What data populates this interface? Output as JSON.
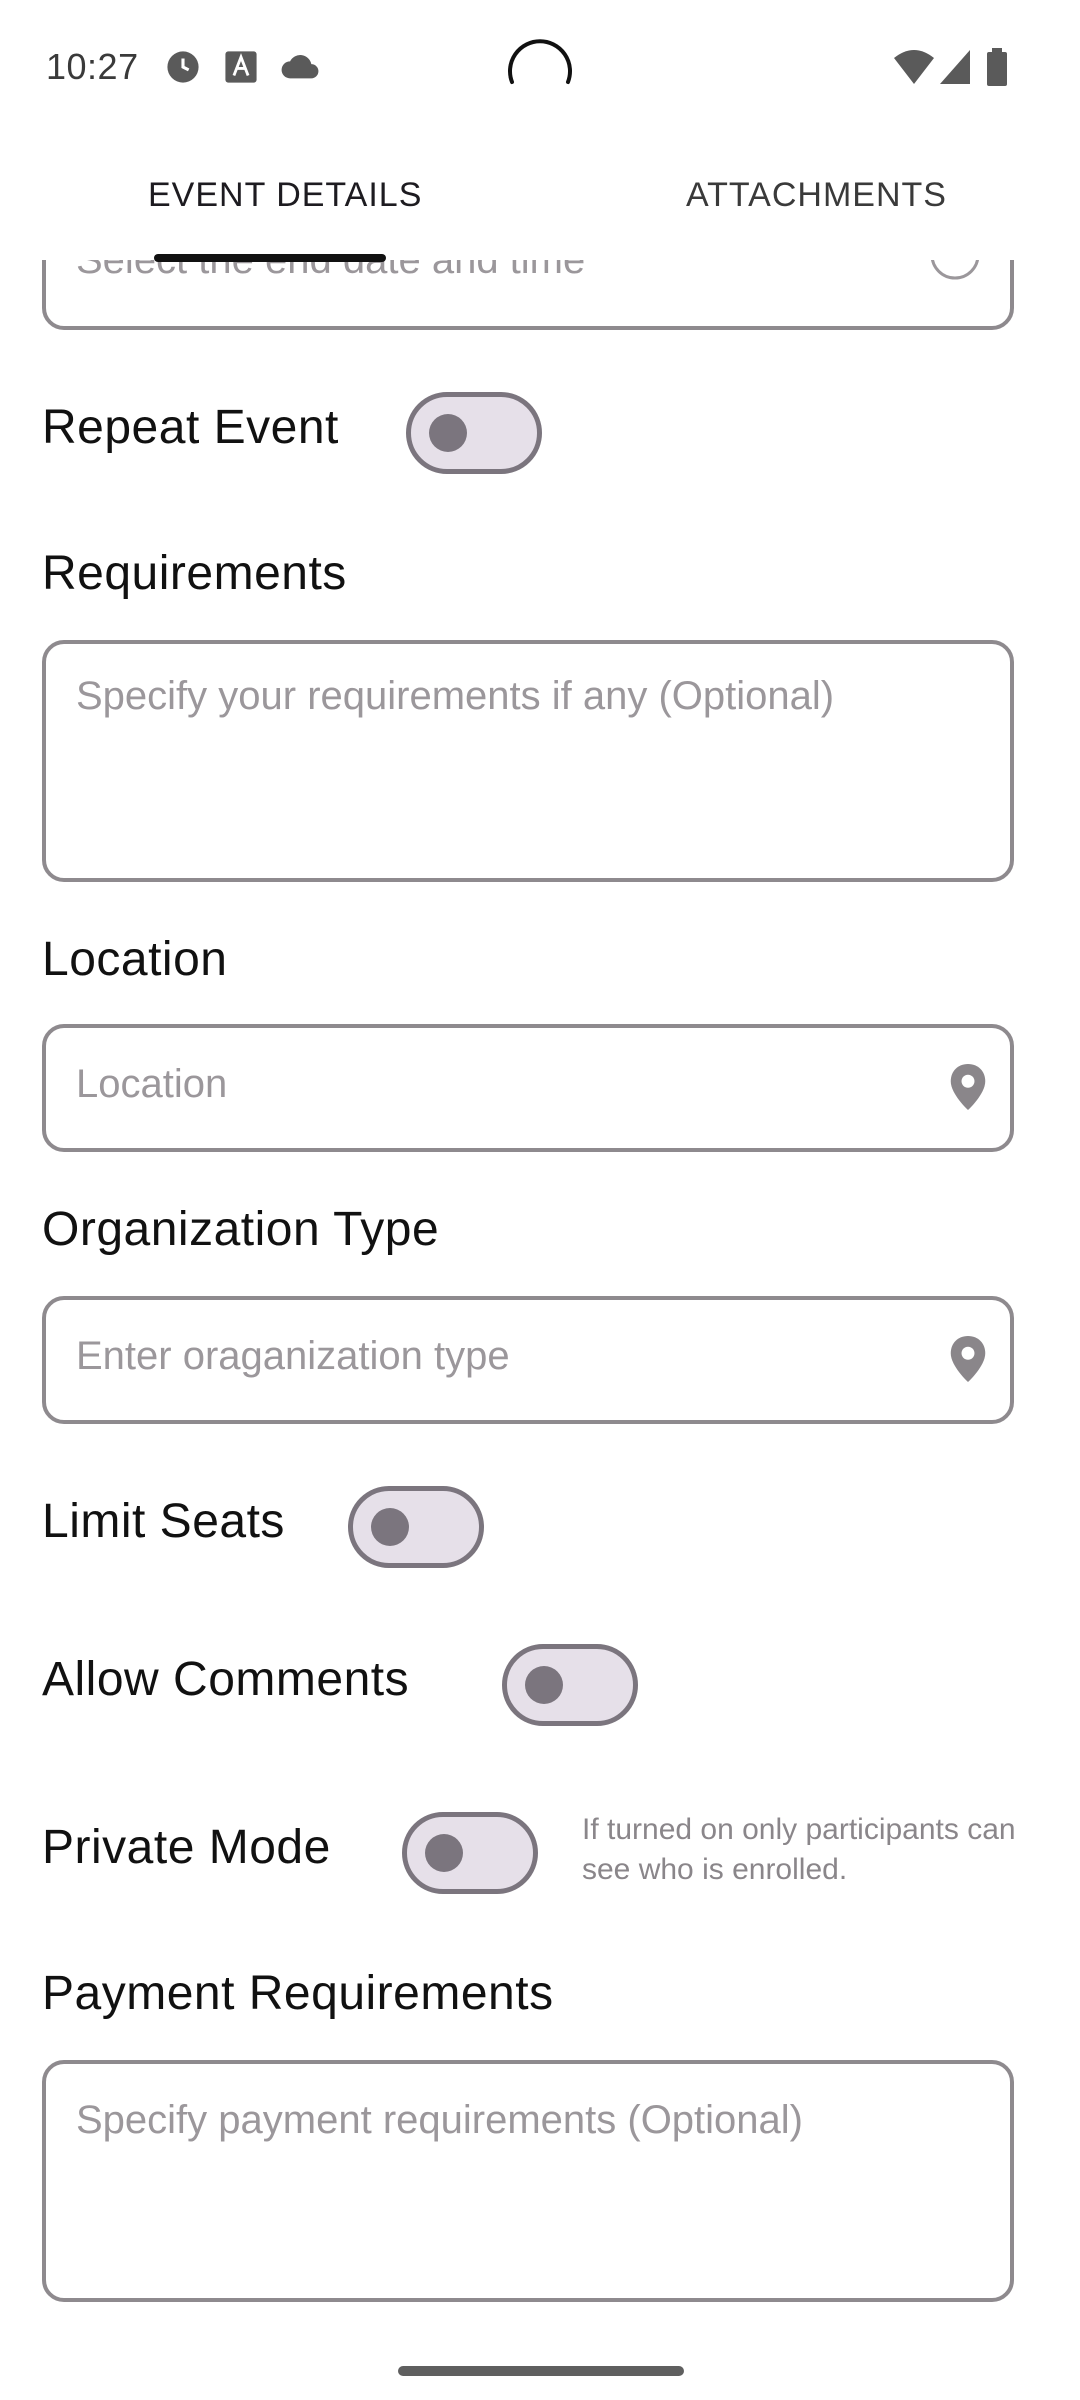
{
  "status_bar": {
    "time": "10:27",
    "icons": [
      "clock-icon",
      "font-icon",
      "cloud-icon",
      "wifi-icon",
      "signal-icon",
      "battery-icon"
    ]
  },
  "tabs": [
    {
      "label": "EVENT DETAILS",
      "active": true
    },
    {
      "label": "ATTACHMENTS",
      "active": false
    }
  ],
  "end_date": {
    "placeholder": "Select the end date and time"
  },
  "repeat_event": {
    "label": "Repeat Event",
    "on": false
  },
  "requirements": {
    "label": "Requirements",
    "placeholder": "Specify your requirements if any (Optional)"
  },
  "location": {
    "label": "Location",
    "placeholder": "Location",
    "icon": "location-pin-icon"
  },
  "organization_type": {
    "label": "Organization Type",
    "placeholder": "Enter oraganization type",
    "icon": "location-pin-icon"
  },
  "limit_seats": {
    "label": "Limit Seats",
    "on": false
  },
  "allow_comments": {
    "label": "Allow Comments",
    "on": false
  },
  "private_mode": {
    "label": "Private Mode",
    "on": false,
    "hint": "If turned on only participants can see who is enrolled."
  },
  "payment_requirements": {
    "label": "Payment Requirements",
    "placeholder": "Specify payment requirements (Optional)"
  },
  "colors": {
    "accent": "#111111",
    "toggle_track": "#e6e0e9",
    "toggle_outline": "#7b757e",
    "field_border": "#8e8a8e"
  }
}
